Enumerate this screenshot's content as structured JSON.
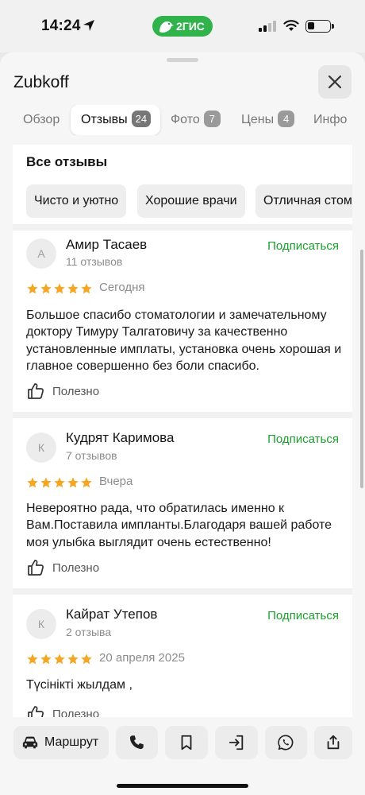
{
  "status_bar": {
    "time": "14:24",
    "app_badge": "2ГИС"
  },
  "header": {
    "title": "Zubkoff"
  },
  "tabs": [
    {
      "label": "Обзор",
      "count": ""
    },
    {
      "label": "Отзывы",
      "count": "24"
    },
    {
      "label": "Фото",
      "count": "7"
    },
    {
      "label": "Цены",
      "count": "4"
    },
    {
      "label": "Инфо",
      "count": ""
    }
  ],
  "reviews_section": {
    "title": "Все отзывы",
    "chips": [
      "Чисто и уютно",
      "Хорошие врачи",
      "Отличная стоматология"
    ]
  },
  "reviews": [
    {
      "initial": "А",
      "name": "Амир Тасаев",
      "count": "11 отзывов",
      "subscribe": "Подписаться",
      "rating": 5,
      "date": "Сегодня",
      "text": "Большое спасибо стоматологии и замечательному доктору Тимуру Талгатовичу за качественно установленные имплаты, установка очень хорошая и главное совершенно без боли спасибо.",
      "useful": "Полезно"
    },
    {
      "initial": "К",
      "name": "Кудрят Каримова",
      "count": "7 отзывов",
      "subscribe": "Подписаться",
      "rating": 5,
      "date": "Вчера",
      "text": "Невероятно рада, что обратилась именно к Вам.Поставила импланты.Благодаря вашей работе моя улыбка выглядит очень естественно!",
      "useful": "Полезно"
    },
    {
      "initial": "К",
      "name": "Кайрат Утепов",
      "count": "2 отзыва",
      "subscribe": "Подписаться",
      "rating": 5,
      "date": "20 апреля 2025",
      "text": "Түсінікті жылдам ,",
      "useful": "Полезно"
    }
  ],
  "bottom_bar": {
    "route_label": "Маршрут"
  },
  "colors": {
    "accent_green": "#1d9f2f",
    "star": "#f5a623",
    "badge_green": "#2fb34a"
  }
}
